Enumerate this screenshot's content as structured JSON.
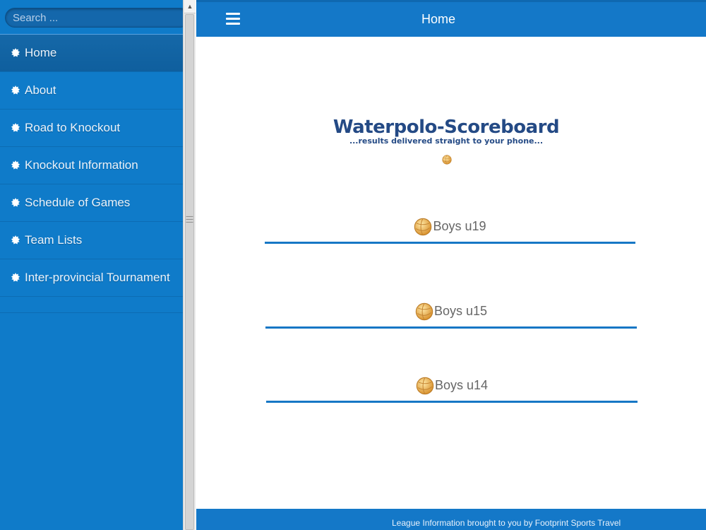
{
  "search": {
    "placeholder": "Search ..."
  },
  "sidebar": {
    "items": [
      {
        "label": "Home",
        "active": true
      },
      {
        "label": "About"
      },
      {
        "label": "Road to Knockout"
      },
      {
        "label": "Knockout Information"
      },
      {
        "label": "Schedule of Games"
      },
      {
        "label": "Team Lists"
      },
      {
        "label": "Inter-provincial Tournament"
      }
    ]
  },
  "header": {
    "title": "Home",
    "menu_icon": "hamburger-icon"
  },
  "brand": {
    "title": "Waterpolo-Scoreboard",
    "subtitle": "...results delivered straight to your phone..."
  },
  "categories": [
    {
      "label": "Boys u19",
      "icon": "water-polo-ball-icon"
    },
    {
      "label": "Boys u15",
      "icon": "water-polo-ball-icon"
    },
    {
      "label": "Boys u14",
      "icon": "water-polo-ball-icon"
    }
  ],
  "footer": {
    "text": "League Information brought to you by Footprint Sports Travel"
  },
  "colors": {
    "sidebar_bg": "#0f7bc9",
    "header_bg": "#1478c8",
    "brand_text": "#244a85",
    "divider": "#1677c5"
  }
}
